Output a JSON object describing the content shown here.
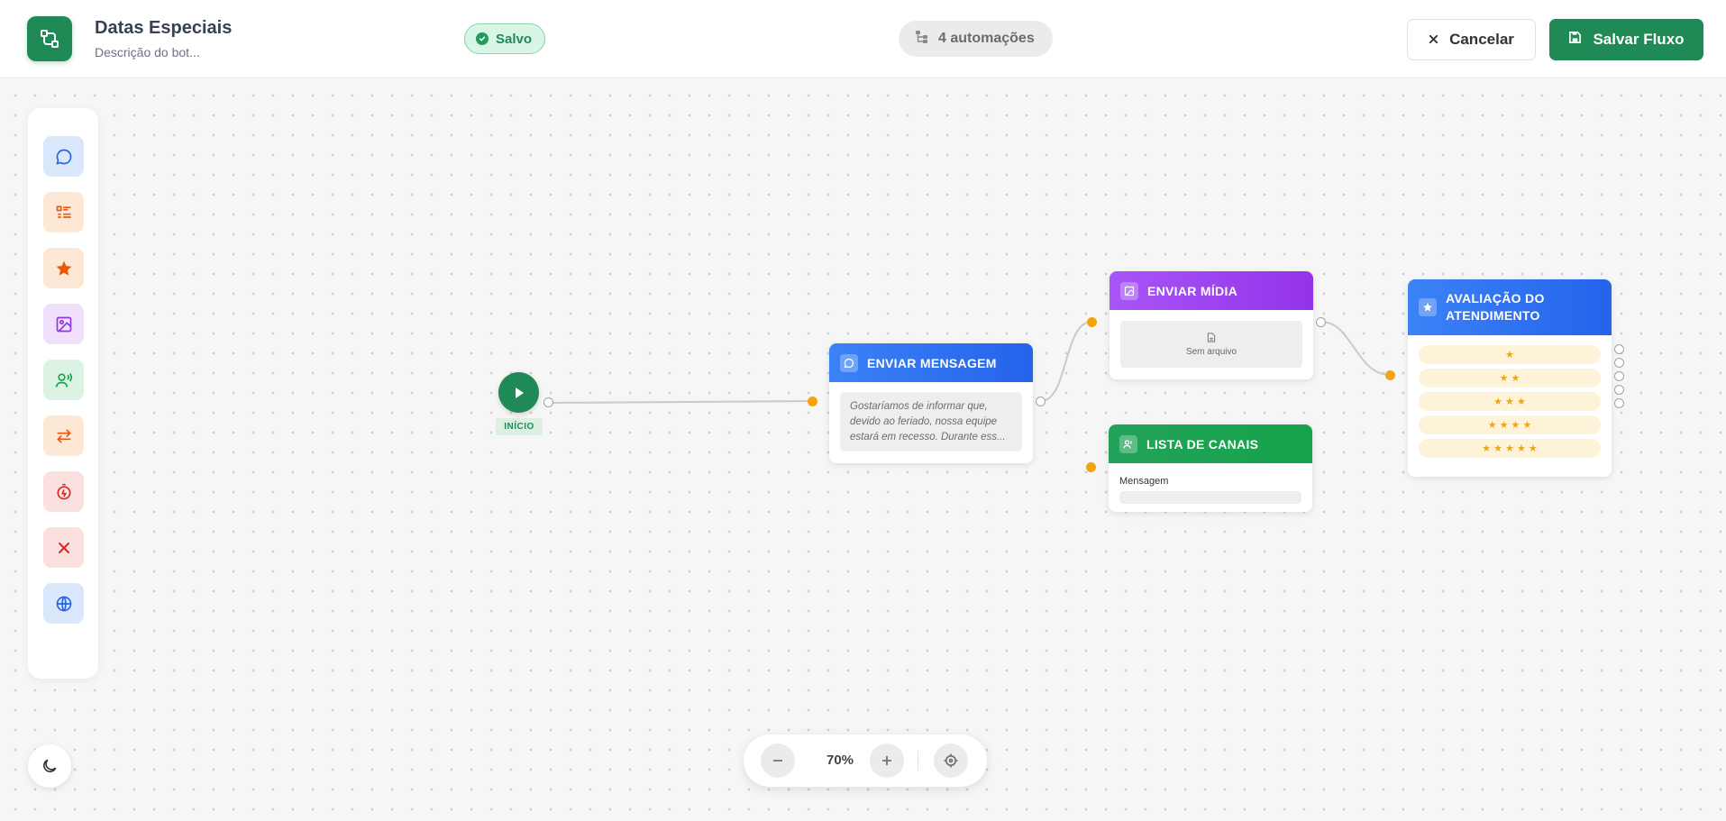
{
  "app": {
    "title": "Datas Especiais",
    "description_placeholder": "Descrição do bot...",
    "status": "Salvo",
    "automations": "4 automações",
    "cancel_label": "Cancelar",
    "save_label": "Salvar Fluxo"
  },
  "sidebar": {
    "tools": [
      {
        "icon": "chat-bubble-icon",
        "color": "#2563eb",
        "bg": "#dbe7fb"
      },
      {
        "icon": "list-icon",
        "color": "#ea580c",
        "bg": "#fde8d6"
      },
      {
        "icon": "star-icon",
        "color": "#ea580c",
        "bg": "#fde8d6"
      },
      {
        "icon": "image-icon",
        "color": "#9333ea",
        "bg": "#f0e0fb"
      },
      {
        "icon": "agent-voice-icon",
        "color": "#16a34a",
        "bg": "#dcf3e4"
      },
      {
        "icon": "transfer-arrows-icon",
        "color": "#ea580c",
        "bg": "#fde8d6"
      },
      {
        "icon": "timer-icon",
        "color": "#dc2626",
        "bg": "#fbe0e0"
      },
      {
        "icon": "close-icon",
        "color": "#dc2626",
        "bg": "#fbe0e0"
      },
      {
        "icon": "globe-icon",
        "color": "#2563eb",
        "bg": "#dbe7fb"
      }
    ]
  },
  "zoom": {
    "value": "70%"
  },
  "nodes": {
    "start": {
      "label": "INÍCIO"
    },
    "send_message": {
      "title": "ENVIAR MENSAGEM",
      "text": "Gostaríamos de informar que, devido ao feriado, nossa equipe estará em recesso. Durante ess..."
    },
    "send_media": {
      "title": "ENVIAR MÍDIA",
      "empty_text": "Sem arquivo"
    },
    "channel_list": {
      "title": "LISTA DE CANAIS",
      "field_label": "Mensagem"
    },
    "rating": {
      "title": "AVALIAÇÃO DO ATENDIMENTO",
      "options": [
        "★",
        "★ ★",
        "★ ★ ★",
        "★ ★ ★ ★",
        "★ ★ ★ ★ ★"
      ]
    }
  },
  "colors": {
    "brand": "#1f8a55",
    "send_message": "#2563eb",
    "send_media": "#9333ea",
    "channel_list": "#16a34a",
    "rating": "#2563eb",
    "port_in": "#f5a30c"
  }
}
